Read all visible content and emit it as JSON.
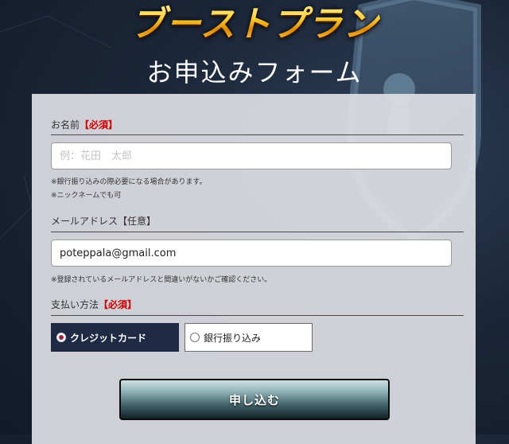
{
  "header": {
    "logo_text": "ブーストプラン",
    "form_title": "お申込みフォーム"
  },
  "form": {
    "name": {
      "label": "お名前",
      "required_tag": "【必須】",
      "placeholder": "例：花田　太郎",
      "value": "",
      "notes": [
        "※銀行振り込みの際必要になる場合があります。",
        "※ニックネームでも可"
      ]
    },
    "email": {
      "label": "メールアドレス【任意】",
      "value": "poteppala@gmail.com",
      "note": "※登録されているメールアドレスと間違いがないかご確認ください。"
    },
    "payment": {
      "label": "支払い方法",
      "required_tag": "【必須】",
      "options": [
        {
          "label": "クレジットカード",
          "selected": true
        },
        {
          "label": "銀行振り込み",
          "selected": false
        }
      ]
    },
    "submit_label": "申し込む"
  },
  "colors": {
    "required": "#cc0000",
    "selected_option_bg": "#1f2b44",
    "radio_dot": "#a0233f"
  }
}
